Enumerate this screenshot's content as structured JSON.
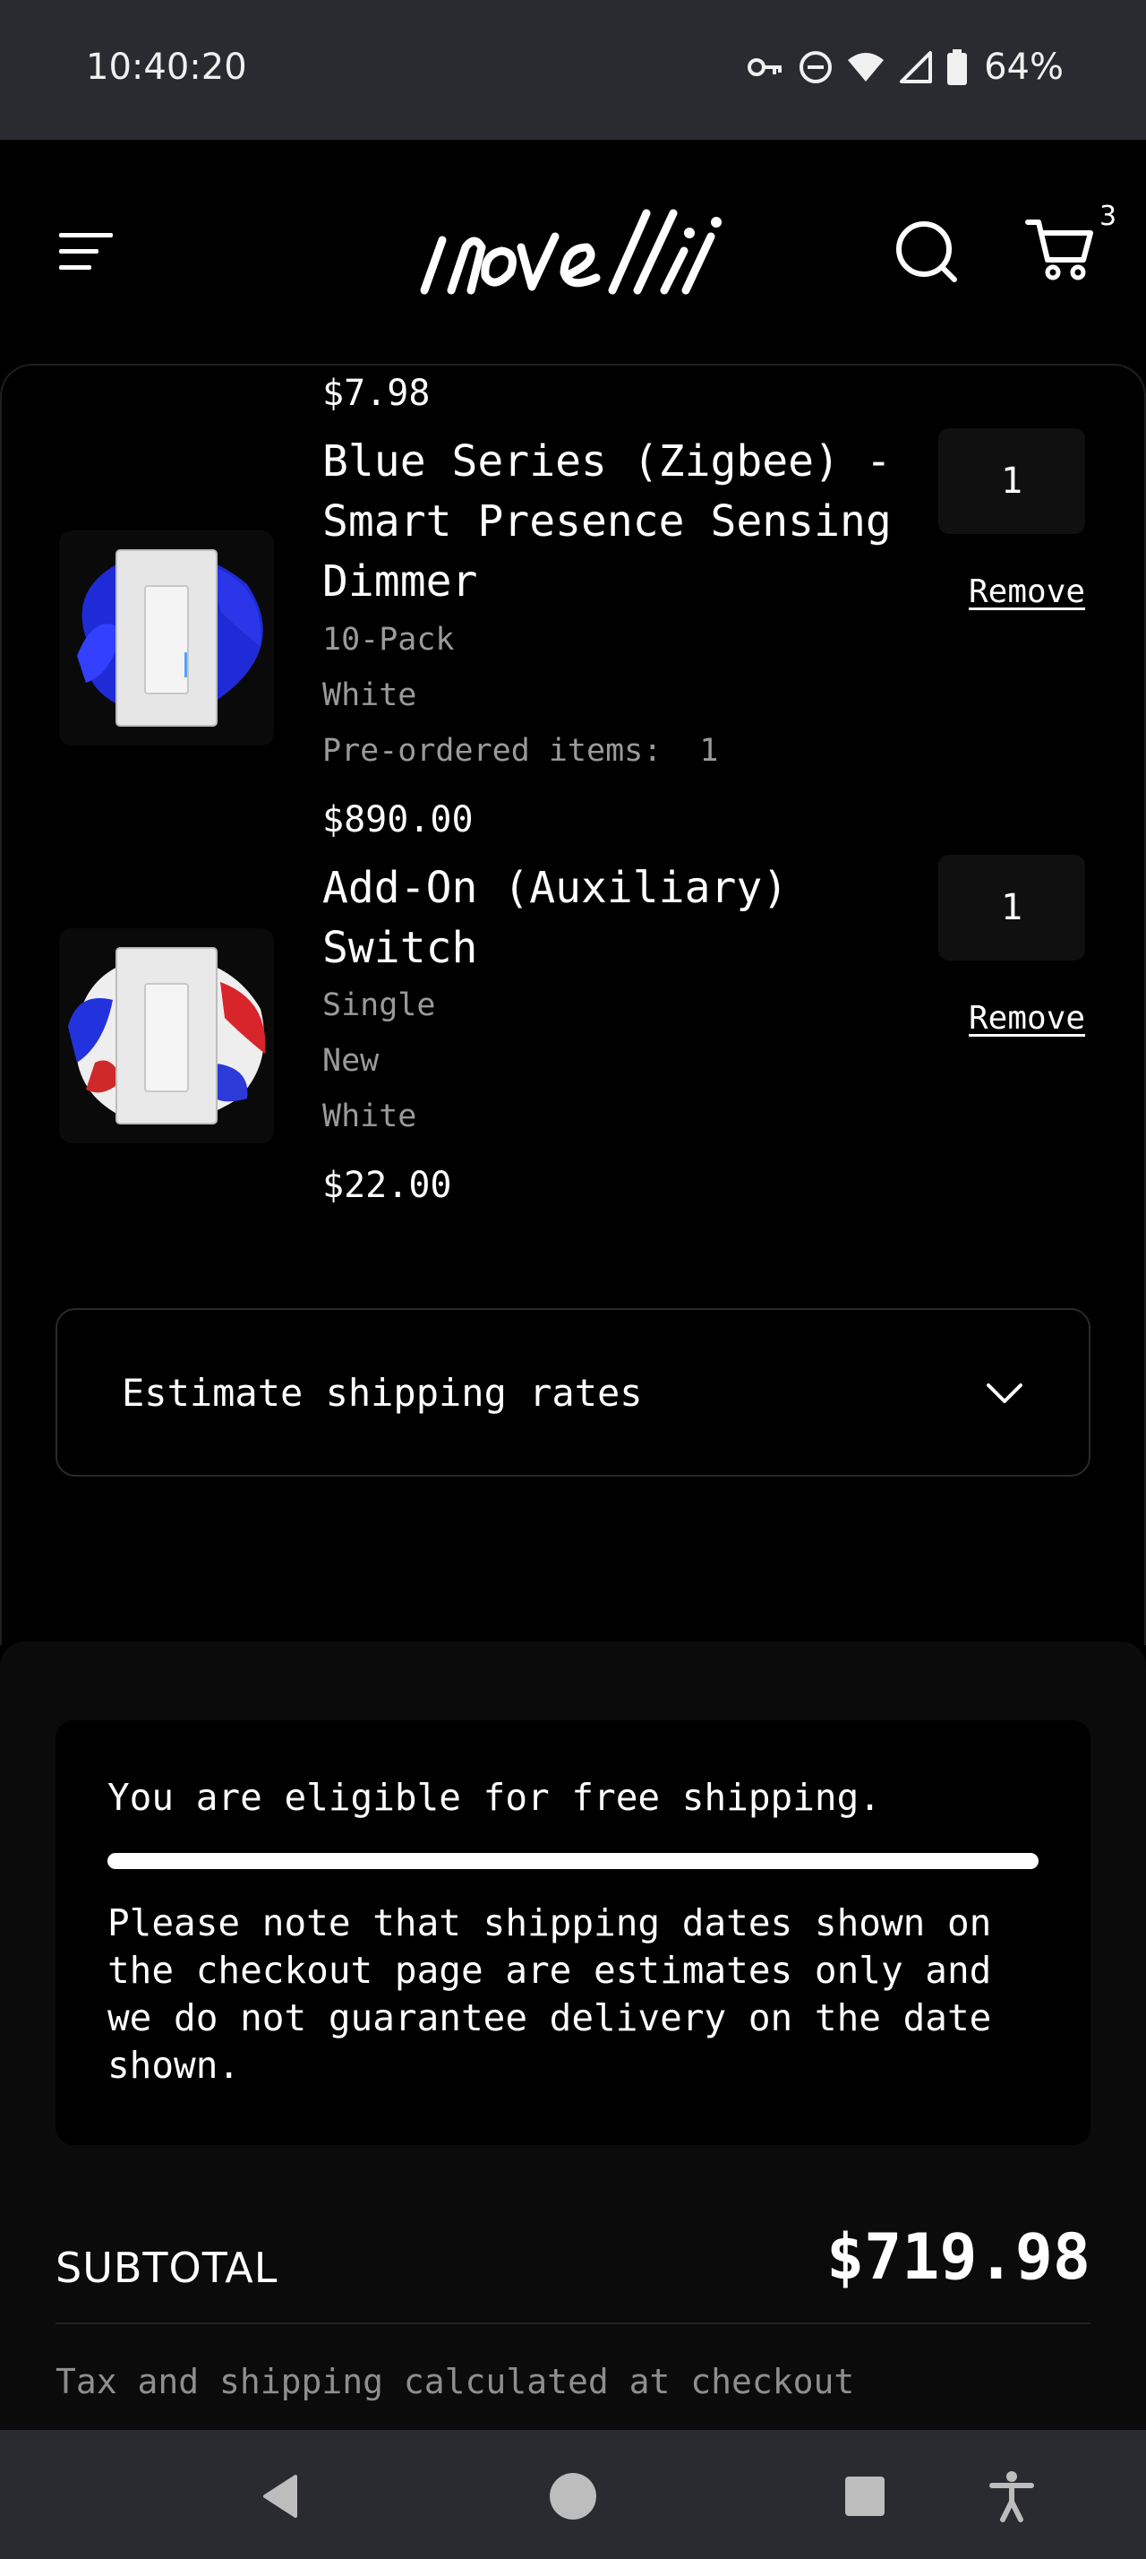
{
  "status_bar": {
    "time": "10:40:20",
    "battery": "64%",
    "icons": [
      "vpn-key-icon",
      "do-not-disturb-icon",
      "wifi-icon",
      "signal-icon",
      "battery-icon"
    ]
  },
  "header": {
    "logo_text": "inovelli",
    "cart_count": "3",
    "icons": [
      "menu-icon",
      "search-icon",
      "cart-icon"
    ]
  },
  "cart": {
    "previous_item_price": "$7.98",
    "items": [
      {
        "title_lines": [
          "Blue Series (Zigbee) -",
          "Smart Presence Sensing",
          "Dimmer"
        ],
        "options": [
          "10-Pack",
          "White",
          "Pre-ordered items:  1"
        ],
        "price": "$890.00",
        "quantity": "1",
        "remove_label": "Remove"
      },
      {
        "title_lines": [
          "Add-On (Auxiliary)",
          "Switch"
        ],
        "options": [
          "Single",
          "New",
          "White"
        ],
        "price": "$22.00",
        "quantity": "1",
        "remove_label": "Remove"
      }
    ],
    "estimate_shipping_label": "Estimate shipping rates"
  },
  "shipping_notice": {
    "title": "You are eligible for free shipping.",
    "progress_fraction": 1.0,
    "body": "Please note that shipping dates shown on the checkout page are estimates only and we do not guarantee delivery on the date shown."
  },
  "summary": {
    "subtotal_label": "SUBTOTAL",
    "subtotal_value": "$719.98",
    "tax_note": "Tax and shipping calculated at checkout"
  },
  "colors": {
    "background": "#000000",
    "system_bars": "#2a2a31",
    "muted_text": "#9a9a9a"
  }
}
